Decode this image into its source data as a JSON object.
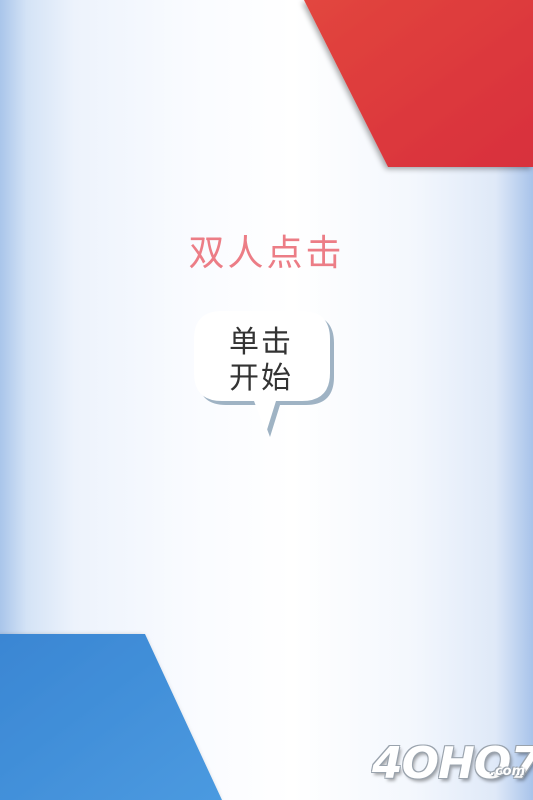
{
  "game": {
    "mode_title": "双人点击",
    "start_bubble_text": "单击\n开始"
  },
  "watermark": {
    "main": "4OHO7",
    "suffix": ".com"
  },
  "colors": {
    "title": "#ec7d86",
    "bubble_text": "#333333",
    "red_corner": "#dc323c",
    "blue_corner": "#3f8fd6"
  },
  "icons": {
    "bubble": "speech-bubble-icon"
  }
}
